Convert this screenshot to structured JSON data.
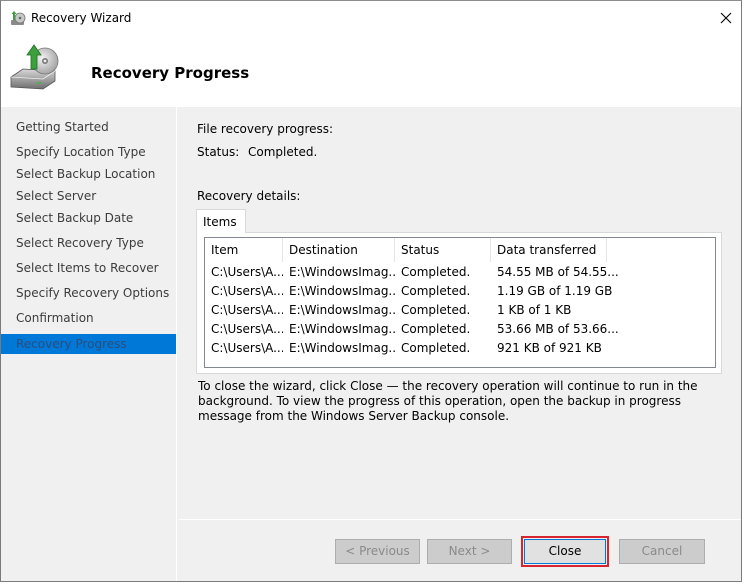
{
  "window": {
    "title": "Recovery Wizard",
    "close_icon": "close-icon"
  },
  "header": {
    "title": "Recovery Progress",
    "icon": "backup-restore-drive-icon"
  },
  "sidebar": {
    "items": [
      {
        "label": "Getting Started",
        "active": false
      },
      {
        "label": "Specify Location Type",
        "active": false
      },
      {
        "label": "Select Backup Location",
        "active": false
      },
      {
        "label": "Select Server",
        "active": false
      },
      {
        "label": "Select Backup Date",
        "active": false
      },
      {
        "label": "Select Recovery Type",
        "active": false
      },
      {
        "label": "Select Items to Recover",
        "active": false
      },
      {
        "label": "Specify Recovery Options",
        "active": false
      },
      {
        "label": "Confirmation",
        "active": false
      },
      {
        "label": "Recovery Progress",
        "active": true
      }
    ],
    "active_color": "#0078d7"
  },
  "main": {
    "progress_label": "File recovery progress:",
    "status_label": "Status:",
    "status_value": "Completed.",
    "details_label": "Recovery details:",
    "tabs": [
      {
        "label": "Items",
        "selected": true
      }
    ],
    "columns": [
      "Item",
      "Destination",
      "Status",
      "Data transferred"
    ],
    "rows": [
      [
        "C:\\Users\\A...",
        "E:\\WindowsImag...",
        "Completed.",
        "54.55 MB of 54.55..."
      ],
      [
        "C:\\Users\\A...",
        "E:\\WindowsImag...",
        "Completed.",
        "1.19 GB of 1.19 GB"
      ],
      [
        "C:\\Users\\A...",
        "E:\\WindowsImag...",
        "Completed.",
        "1 KB of 1 KB"
      ],
      [
        "C:\\Users\\A...",
        "E:\\WindowsImag...",
        "Completed.",
        "53.66 MB of 53.66..."
      ],
      [
        "C:\\Users\\A...",
        "E:\\WindowsImag...",
        "Completed.",
        "921 KB of 921 KB"
      ]
    ],
    "note": "To close the wizard, click Close — the recovery operation will continue to run in the background. To view the progress of this operation, open the backup in progress message from the Windows Server Backup console."
  },
  "footer": {
    "previous_label": "< Previous",
    "next_label": "Next >",
    "close_label": "Close",
    "cancel_label": "Cancel",
    "highlight_color": "#d9232e"
  }
}
